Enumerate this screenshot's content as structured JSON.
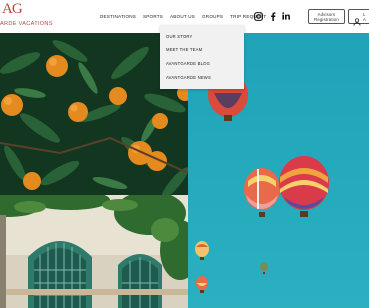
{
  "brand": {
    "mark": "AG",
    "text": "ARDE VACATIONS",
    "accent": "#b44a3e"
  },
  "nav": {
    "items": [
      "DESTINATIONS",
      "SPORTS",
      "ABOUT US",
      "GROUPS",
      "TRIP REQUEST"
    ]
  },
  "social": [
    "instagram-icon",
    "facebook-icon",
    "linkedin-icon"
  ],
  "advisors": {
    "line1": "Advisors",
    "line2": "Registration"
  },
  "login": {
    "line1": "L",
    "line2": "A"
  },
  "dropdown": {
    "items": [
      "OUR STORY",
      "MEET THE TEAM",
      "AVANTGARDE BLOG",
      "AVANTGARDE NEWS"
    ]
  },
  "colors": {
    "sky": "#1fa3b8",
    "foliage": "#1d4d2b",
    "orange": "#e58a1f",
    "tile": "#2e7a6b"
  }
}
